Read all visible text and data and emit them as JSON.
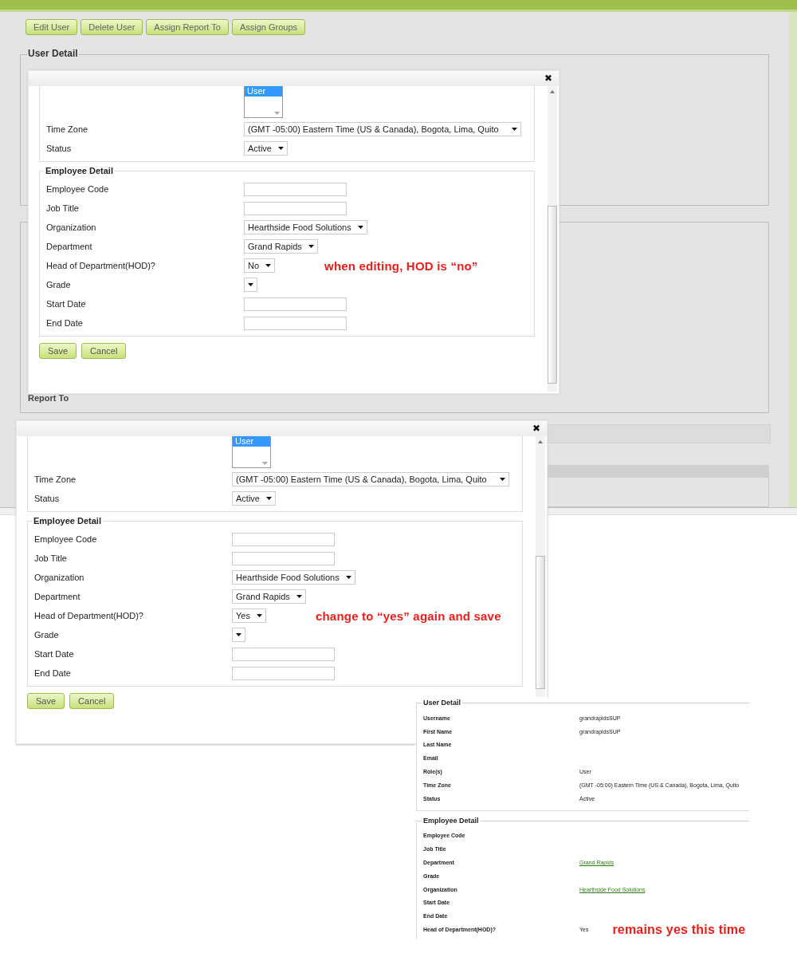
{
  "page": {
    "toolbar": [
      "Edit User",
      "Delete User",
      "Assign Report To",
      "Assign Groups"
    ],
    "section_title": "User Detail",
    "report_to_label": "Report To"
  },
  "dialogs": [
    {
      "close": "✖",
      "roles": [
        {
          "label": "User",
          "selected": true
        }
      ],
      "user_fields": [
        {
          "label": "Time Zone",
          "kind": "select",
          "value": "(GMT -05:00) Eastern Time (US & Canada), Bogota, Lima, Quito"
        },
        {
          "label": "Status",
          "kind": "select",
          "value": "Active"
        }
      ],
      "employee_title": "Employee Detail",
      "employee_fields": [
        {
          "label": "Employee Code",
          "kind": "text"
        },
        {
          "label": "Job Title",
          "kind": "text"
        },
        {
          "label": "Organization",
          "kind": "select",
          "value": "Hearthside Food Solutions"
        },
        {
          "label": "Department",
          "kind": "select",
          "value": "Grand Rapids"
        },
        {
          "label": "Head of Department(HOD)?",
          "kind": "select",
          "value": "No",
          "note": "when editing, HOD is “no”"
        },
        {
          "label": "Grade",
          "kind": "select"
        },
        {
          "label": "Start Date",
          "kind": "text"
        },
        {
          "label": "End Date",
          "kind": "text"
        }
      ],
      "buttons": [
        "Save",
        "Cancel"
      ]
    },
    {
      "close": "✖",
      "roles": [
        {
          "label": "User",
          "selected": true
        }
      ],
      "user_fields": [
        {
          "label": "Time Zone",
          "kind": "select",
          "value": "(GMT -05:00) Eastern Time (US & Canada), Bogota, Lima, Quito"
        },
        {
          "label": "Status",
          "kind": "select",
          "value": "Active"
        }
      ],
      "employee_title": "Employee Detail",
      "employee_fields": [
        {
          "label": "Employee Code",
          "kind": "text"
        },
        {
          "label": "Job Title",
          "kind": "text"
        },
        {
          "label": "Organization",
          "kind": "select",
          "value": "Hearthside Food Solutions"
        },
        {
          "label": "Department",
          "kind": "select",
          "value": "Grand Rapids"
        },
        {
          "label": "Head of Department(HOD)?",
          "kind": "select",
          "value": "Yes",
          "note": "change to “yes” again and save"
        },
        {
          "label": "Grade",
          "kind": "select"
        },
        {
          "label": "Start Date",
          "kind": "text"
        },
        {
          "label": "End Date",
          "kind": "text"
        }
      ],
      "buttons": [
        "Save",
        "Cancel"
      ]
    }
  ],
  "saved_detail": {
    "sections": [
      {
        "title": "User Detail",
        "rows": [
          {
            "label": "Username",
            "kind": "text",
            "value": "grandrapidsSUP"
          },
          {
            "label": "First Name",
            "kind": "text",
            "value": "grandrapidsSUP"
          },
          {
            "label": "Last Name"
          },
          {
            "label": "Email"
          },
          {
            "label": "Role(s)",
            "kind": "text",
            "value": "User"
          },
          {
            "label": "Time Zone",
            "kind": "text",
            "value": "(GMT -05:00) Eastern Time (US & Canada), Bogota, Lima, Quito"
          },
          {
            "label": "Status",
            "kind": "text",
            "value": "Active"
          }
        ]
      },
      {
        "title": "Employee Detail",
        "rows": [
          {
            "label": "Employee Code"
          },
          {
            "label": "Job Title"
          },
          {
            "label": "Department",
            "kind": "link",
            "value": "Grand Rapids"
          },
          {
            "label": "Grade"
          },
          {
            "label": "Organization",
            "kind": "link",
            "value": "Hearthside Food Solutions"
          },
          {
            "label": "Start Date"
          },
          {
            "label": "End Date"
          },
          {
            "label": "Head of Department(HOD)?",
            "kind": "text",
            "value": "Yes",
            "note": "remains yes this time"
          }
        ]
      }
    ]
  }
}
